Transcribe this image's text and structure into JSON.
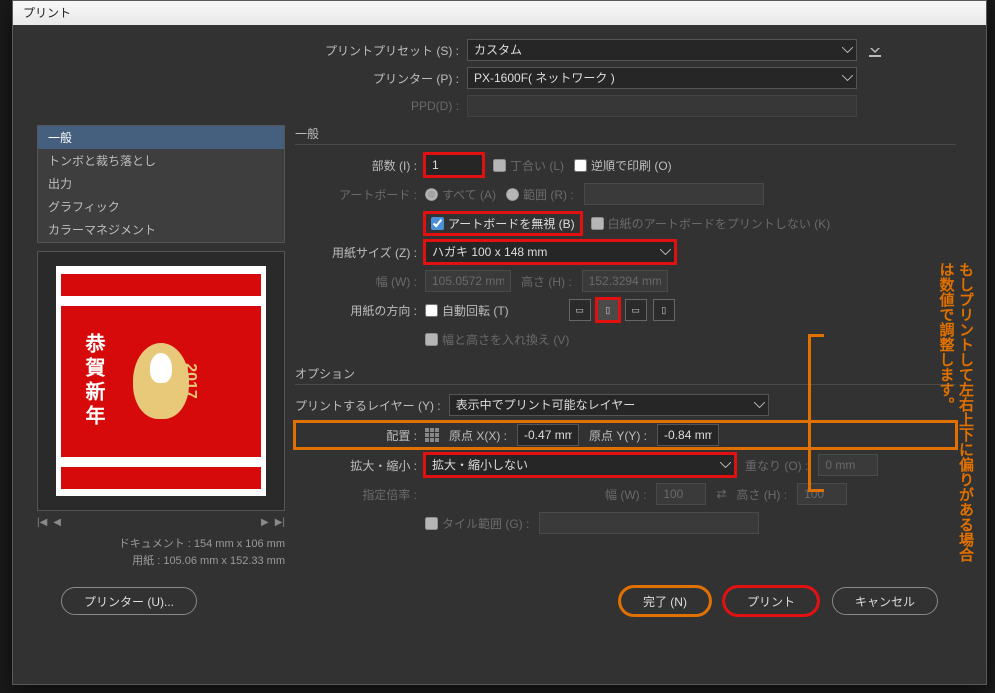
{
  "window": {
    "title": "プリント"
  },
  "top": {
    "preset_label": "プリントプリセット (S) :",
    "preset_value": "カスタム",
    "printer_label": "プリンター (P) :",
    "printer_value": "PX-1600F( ネットワーク )",
    "ppd_label": "PPD(D) :",
    "ppd_value": ""
  },
  "sidebar": {
    "items": [
      "一般",
      "トンボと裁ち落とし",
      "出力",
      "グラフィック",
      "カラーマネジメント"
    ]
  },
  "preview": {
    "card_greeting": "恭賀新年",
    "card_year": "2017",
    "doc_line": "ドキュメント : 154 mm x 106 mm",
    "paper_line": "用紙 : 105.06 mm x 152.33 mm"
  },
  "general": {
    "title": "一般",
    "copies_label": "部数 (I) :",
    "copies_value": "1",
    "collate_label": "丁合い (L)",
    "reverse_label": "逆順で印刷 (O)",
    "artboard_label": "アートボード :",
    "artboard_all": "すべて (A)",
    "artboard_range": "範囲 (R) :",
    "ignore_ab_label": "アートボードを無視 (B)",
    "blank_ab_label": "白紙のアートボードをプリントしない (K)",
    "paper_size_label": "用紙サイズ (Z) :",
    "paper_size_value": "ハガキ 100 x 148 mm",
    "width_label": "幅 (W) :",
    "width_value": "105.0572 mm",
    "height_label": "高さ (H) :",
    "height_value": "152.3294 mm",
    "orient_label": "用紙の方向 :",
    "auto_rotate_label": "自動回転 (T)",
    "swap_wh_label": "幅と高さを入れ換え (V)"
  },
  "options": {
    "title": "オプション",
    "layers_label": "プリントするレイヤー (Y) :",
    "layers_value": "表示中でプリント可能なレイヤー",
    "placement_label": "配置 :",
    "origin_x_label": "原点 X(X) :",
    "origin_x_value": "-0.47 mm",
    "origin_y_label": "原点 Y(Y) :",
    "origin_y_value": "-0.84 mm",
    "scale_label": "拡大・縮小 :",
    "scale_value": "拡大・縮小しない",
    "overlap_label": "重なり (O) :",
    "overlap_value": "0 mm",
    "ratio_label": "指定倍率 :",
    "ratio_w_label": "幅 (W) :",
    "ratio_w_value": "100",
    "ratio_h_label": "高さ (H) :",
    "ratio_h_value": "100",
    "tile_range_label": "タイル範囲 (G) :"
  },
  "footer": {
    "printer_btn": "プリンター (U)...",
    "done_btn": "完了 (N)",
    "print_btn": "プリント",
    "cancel_btn": "キャンセル"
  },
  "annotation": "もしプリントして左右上下に偏りがある場合は数値で調整します。"
}
